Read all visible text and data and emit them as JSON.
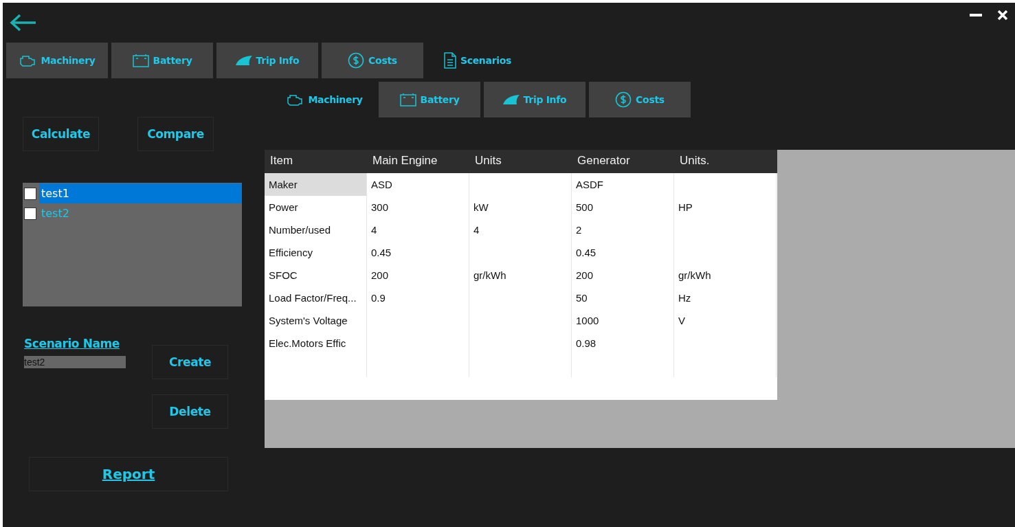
{
  "main_tabs": [
    {
      "label": "Machinery",
      "selected": false
    },
    {
      "label": "Battery",
      "selected": false
    },
    {
      "label": "Trip Info",
      "selected": false
    },
    {
      "label": "Costs",
      "selected": false
    },
    {
      "label": "Scenarios",
      "selected": true
    }
  ],
  "actions": [
    "Calculate",
    "Compare"
  ],
  "scenario_list": [
    {
      "label": "test1",
      "checked": false,
      "selected": true
    },
    {
      "label": "test2",
      "checked": false,
      "selected": false
    }
  ],
  "scenario_name": {
    "label": "Scenario Name",
    "value": "test2"
  },
  "scenario_buttons": [
    "Create",
    "Delete"
  ],
  "report_link": "Report",
  "sub_tabs": [
    {
      "label": "Machinery",
      "selected": true
    },
    {
      "label": "Battery",
      "selected": false
    },
    {
      "label": "Trip Info",
      "selected": false
    },
    {
      "label": "Costs",
      "selected": false
    }
  ],
  "table": {
    "columns": [
      "Item",
      "Main Engine",
      "Units",
      "Generator",
      "Units."
    ],
    "rows": [
      {
        "selected": true,
        "cells": [
          "Maker",
          "ASD",
          null,
          "ASDF",
          null
        ]
      },
      {
        "selected": false,
        "cells": [
          "Power",
          "300",
          "kW",
          "500",
          "HP"
        ]
      },
      {
        "selected": false,
        "cells": [
          "Number/used",
          "4",
          "4",
          "2",
          null
        ]
      },
      {
        "selected": false,
        "cells": [
          "Efficiency",
          "0.45",
          null,
          "0.45",
          null
        ]
      },
      {
        "selected": false,
        "cells": [
          "SFOC",
          "200",
          "gr/kWh",
          "200",
          "gr/kWh"
        ]
      },
      {
        "selected": false,
        "cells": [
          "Load Factor/Freq...",
          "0.9",
          null,
          "50",
          "Hz"
        ]
      },
      {
        "selected": false,
        "cells": [
          "System's Voltage",
          null,
          null,
          "1000",
          "V"
        ]
      },
      {
        "selected": false,
        "cells": [
          "Elec.Motors Effic",
          null,
          null,
          "0.98",
          null
        ]
      }
    ]
  }
}
